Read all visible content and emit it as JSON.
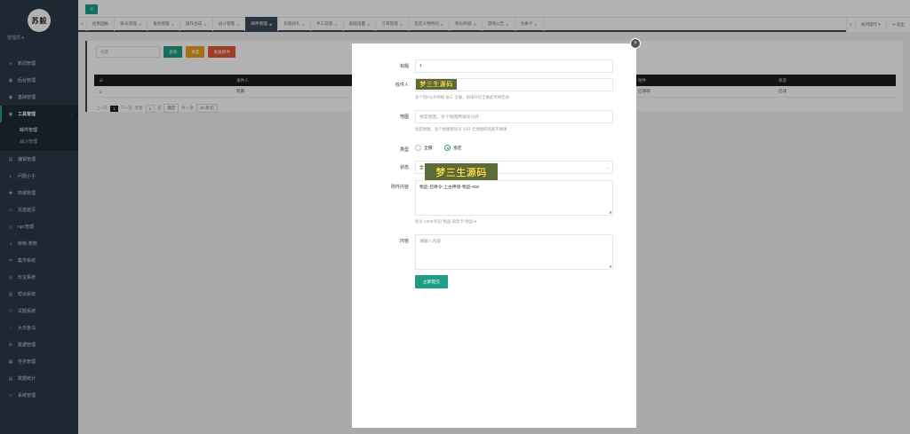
{
  "sidebar": {
    "logo_text": "苏",
    "logo_text2": "毅",
    "admin_name": "管理员 ▾",
    "items": [
      {
        "icon": "∞",
        "label": "新闻管理"
      },
      {
        "icon": "▣",
        "label": "后台管理"
      },
      {
        "icon": "▣",
        "label": "基础管理"
      },
      {
        "icon": "▣",
        "label": "工具管理",
        "open": true
      },
      {
        "icon": "▤",
        "label": "编辑管理"
      },
      {
        "icon": "◐",
        "label": "问题小子"
      },
      {
        "icon": "✱",
        "label": "商城管理"
      },
      {
        "icon": "▭",
        "label": "充值首页"
      },
      {
        "icon": "◻",
        "label": "npc管理"
      },
      {
        "icon": "◑",
        "label": "特物·宠物"
      },
      {
        "icon": "⇋",
        "label": "集市系统"
      },
      {
        "icon": "◎",
        "label": "珍宝系统"
      },
      {
        "icon": "▥",
        "label": "帮派系统"
      },
      {
        "icon": "⚇",
        "label": "试题系统"
      },
      {
        "icon": "◌",
        "label": "大日金乌"
      },
      {
        "icon": "⚙",
        "label": "数据管理"
      },
      {
        "icon": "▦",
        "label": "任务管理"
      },
      {
        "icon": "▤",
        "label": "数据统计"
      },
      {
        "icon": "▭",
        "label": "系统管理"
      }
    ],
    "subitems": [
      "邮件管理",
      "战斗管理"
    ]
  },
  "tabs": {
    "items": [
      {
        "label": "控制面板",
        "active": false,
        "closable": false
      },
      {
        "label": "账号管理",
        "active": false,
        "closable": true
      },
      {
        "label": "角色管理",
        "active": false,
        "closable": true
      },
      {
        "label": "操作合成",
        "active": false,
        "closable": true
      },
      {
        "label": "战斗管理",
        "active": false,
        "closable": true
      },
      {
        "label": "邮件管理",
        "active": true,
        "closable": true
      },
      {
        "label": "充值好礼",
        "active": false,
        "closable": true
      },
      {
        "label": "手工充值",
        "active": false,
        "closable": true
      },
      {
        "label": "基础设置",
        "active": false,
        "closable": true
      },
      {
        "label": "订单管理",
        "active": false,
        "closable": true
      },
      {
        "label": "自定义物特别",
        "active": false,
        "closable": true
      },
      {
        "label": "积分商城",
        "active": false,
        "closable": true
      },
      {
        "label": "游戏公告",
        "active": false,
        "closable": true
      },
      {
        "label": "兑换卡",
        "active": false,
        "closable": true
      }
    ],
    "right_action": "关闭操作 ▾",
    "logout": "⇥ 退出"
  },
  "list": {
    "search_placeholder": "标题",
    "btn_search": "查询",
    "btn_reset": "重置",
    "btn_send": "发送邮件",
    "columns": [
      "id",
      "发件人",
      "附件",
      "状态"
    ],
    "row": [
      "1",
      "玩家",
      "已领取",
      "已读"
    ],
    "pager": {
      "prev": "上一页",
      "cur": "1",
      "next": "下一页",
      "goto": "到第",
      "page_input": "1",
      "page_unit": "页",
      "confirm": "确定",
      "total": "共 1 条",
      "per_page": "15 条/页"
    }
  },
  "modal": {
    "close_icon": "×",
    "title_label": "标题",
    "title_value": "1",
    "recipient_label": "收件人",
    "recipient_hint": "多个用#分开例如 张三 全服，如果开启全服此项将无效",
    "map_label": "地图",
    "map_placeholder": "指定地图，多个地图用逗号分开",
    "map_hint": "指定地图，多个地图用逗号 分开 全地图的话就不要填",
    "type_label": "类型",
    "type_options": [
      "全服",
      "指定"
    ],
    "status_label": "状态",
    "status_value": "全",
    "attach_label": "附件内容",
    "attach_value": "物品-召唤令·上古神兽-物品-900",
    "attach_hint": "积分-1000-积分 物品-简年卡-物品-5",
    "content_label": "内容",
    "content_placeholder": "请输入内容",
    "submit": "立即提交",
    "watermark": "梦三生源码"
  }
}
